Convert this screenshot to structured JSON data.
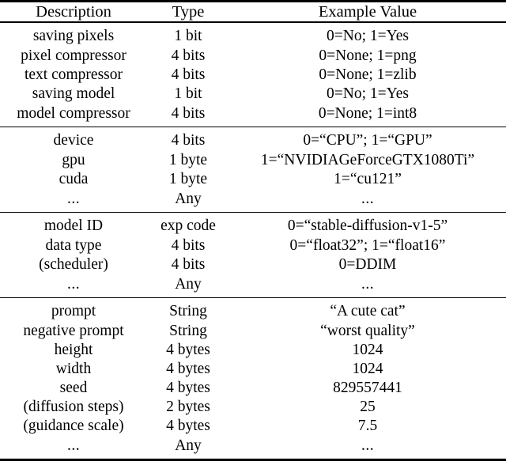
{
  "table": {
    "columns": [
      {
        "key": "description",
        "header": "Description"
      },
      {
        "key": "type",
        "header": "Type"
      },
      {
        "key": "value",
        "header": "Example Value"
      }
    ],
    "groups": [
      {
        "name": "storage-options",
        "rows": [
          {
            "description": "saving pixels",
            "type": "1 bit",
            "value": "0=No; 1=Yes"
          },
          {
            "description": "pixel compressor",
            "type": "4 bits",
            "value": "0=None; 1=png"
          },
          {
            "description": "text compressor",
            "type": "4 bits",
            "value": "0=None; 1=zlib"
          },
          {
            "description": "saving model",
            "type": "1 bit",
            "value": "0=No; 1=Yes"
          },
          {
            "description": "model compressor",
            "type": "4 bits",
            "value": "0=None; 1=int8"
          }
        ]
      },
      {
        "name": "hardware-environment",
        "rows": [
          {
            "description": "device",
            "type": "4 bits",
            "value": "0=“CPU”; 1=“GPU”"
          },
          {
            "description": "gpu",
            "type": "1 byte",
            "value": "1=“NVIDIAGeForceGTX1080Ti”"
          },
          {
            "description": "cuda",
            "type": "1 byte",
            "value": "1=“cu121”"
          },
          {
            "description": "...",
            "type": "Any",
            "value": "..."
          }
        ]
      },
      {
        "name": "model-configuration",
        "rows": [
          {
            "description": "model ID",
            "type": "exp code",
            "value": "0=“stable-diffusion-v1-5”"
          },
          {
            "description": "data type",
            "type": "4 bits",
            "value": "0=“float32”; 1=“float16”"
          },
          {
            "description": "(scheduler)",
            "type": "4 bits",
            "value": "0=DDIM"
          },
          {
            "description": "...",
            "type": "Any",
            "value": "..."
          }
        ]
      },
      {
        "name": "generation-parameters",
        "rows": [
          {
            "description": "prompt",
            "type": "String",
            "value": "“A cute cat”"
          },
          {
            "description": "negative prompt",
            "type": "String",
            "value": "“worst quality”"
          },
          {
            "description": "height",
            "type": "4 bytes",
            "value": "1024"
          },
          {
            "description": "width",
            "type": "4 bytes",
            "value": "1024"
          },
          {
            "description": "seed",
            "type": "4 bytes",
            "value": "829557441"
          },
          {
            "description": "(diffusion steps)",
            "type": "2 bytes",
            "value": "25"
          },
          {
            "description": "(guidance scale)",
            "type": "4 bytes",
            "value": "7.5"
          },
          {
            "description": "...",
            "type": "Any",
            "value": "..."
          }
        ]
      }
    ]
  }
}
